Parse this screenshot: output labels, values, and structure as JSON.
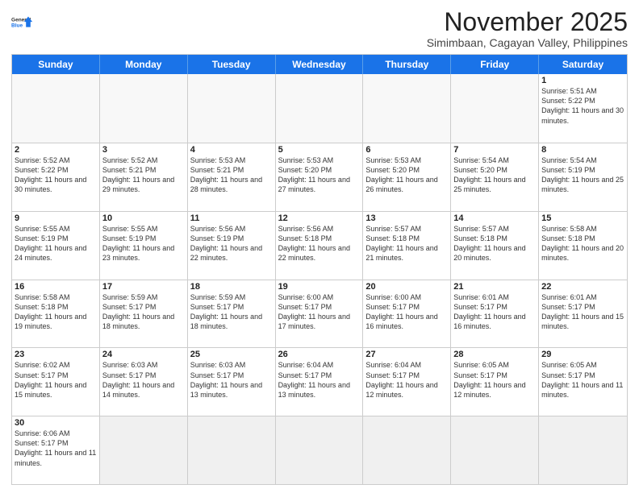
{
  "header": {
    "logo_general": "General",
    "logo_blue": "Blue",
    "month_title": "November 2025",
    "location": "Simimbaan, Cagayan Valley, Philippines"
  },
  "weekdays": [
    "Sunday",
    "Monday",
    "Tuesday",
    "Wednesday",
    "Thursday",
    "Friday",
    "Saturday"
  ],
  "rows": [
    [
      {
        "day": "",
        "info": "",
        "bg": "empty"
      },
      {
        "day": "",
        "info": "",
        "bg": "empty"
      },
      {
        "day": "",
        "info": "",
        "bg": "empty"
      },
      {
        "day": "",
        "info": "",
        "bg": "empty"
      },
      {
        "day": "",
        "info": "",
        "bg": "empty"
      },
      {
        "day": "",
        "info": "",
        "bg": "empty"
      },
      {
        "day": "1",
        "info": "Sunrise: 5:51 AM\nSunset: 5:22 PM\nDaylight: 11 hours and 30 minutes.",
        "bg": ""
      }
    ],
    [
      {
        "day": "2",
        "info": "Sunrise: 5:52 AM\nSunset: 5:22 PM\nDaylight: 11 hours and 30 minutes.",
        "bg": ""
      },
      {
        "day": "3",
        "info": "Sunrise: 5:52 AM\nSunset: 5:21 PM\nDaylight: 11 hours and 29 minutes.",
        "bg": ""
      },
      {
        "day": "4",
        "info": "Sunrise: 5:53 AM\nSunset: 5:21 PM\nDaylight: 11 hours and 28 minutes.",
        "bg": ""
      },
      {
        "day": "5",
        "info": "Sunrise: 5:53 AM\nSunset: 5:20 PM\nDaylight: 11 hours and 27 minutes.",
        "bg": ""
      },
      {
        "day": "6",
        "info": "Sunrise: 5:53 AM\nSunset: 5:20 PM\nDaylight: 11 hours and 26 minutes.",
        "bg": ""
      },
      {
        "day": "7",
        "info": "Sunrise: 5:54 AM\nSunset: 5:20 PM\nDaylight: 11 hours and 25 minutes.",
        "bg": ""
      },
      {
        "day": "8",
        "info": "Sunrise: 5:54 AM\nSunset: 5:19 PM\nDaylight: 11 hours and 25 minutes.",
        "bg": ""
      }
    ],
    [
      {
        "day": "9",
        "info": "Sunrise: 5:55 AM\nSunset: 5:19 PM\nDaylight: 11 hours and 24 minutes.",
        "bg": ""
      },
      {
        "day": "10",
        "info": "Sunrise: 5:55 AM\nSunset: 5:19 PM\nDaylight: 11 hours and 23 minutes.",
        "bg": ""
      },
      {
        "day": "11",
        "info": "Sunrise: 5:56 AM\nSunset: 5:19 PM\nDaylight: 11 hours and 22 minutes.",
        "bg": ""
      },
      {
        "day": "12",
        "info": "Sunrise: 5:56 AM\nSunset: 5:18 PM\nDaylight: 11 hours and 22 minutes.",
        "bg": ""
      },
      {
        "day": "13",
        "info": "Sunrise: 5:57 AM\nSunset: 5:18 PM\nDaylight: 11 hours and 21 minutes.",
        "bg": ""
      },
      {
        "day": "14",
        "info": "Sunrise: 5:57 AM\nSunset: 5:18 PM\nDaylight: 11 hours and 20 minutes.",
        "bg": ""
      },
      {
        "day": "15",
        "info": "Sunrise: 5:58 AM\nSunset: 5:18 PM\nDaylight: 11 hours and 20 minutes.",
        "bg": ""
      }
    ],
    [
      {
        "day": "16",
        "info": "Sunrise: 5:58 AM\nSunset: 5:18 PM\nDaylight: 11 hours and 19 minutes.",
        "bg": ""
      },
      {
        "day": "17",
        "info": "Sunrise: 5:59 AM\nSunset: 5:17 PM\nDaylight: 11 hours and 18 minutes.",
        "bg": ""
      },
      {
        "day": "18",
        "info": "Sunrise: 5:59 AM\nSunset: 5:17 PM\nDaylight: 11 hours and 18 minutes.",
        "bg": ""
      },
      {
        "day": "19",
        "info": "Sunrise: 6:00 AM\nSunset: 5:17 PM\nDaylight: 11 hours and 17 minutes.",
        "bg": ""
      },
      {
        "day": "20",
        "info": "Sunrise: 6:00 AM\nSunset: 5:17 PM\nDaylight: 11 hours and 16 minutes.",
        "bg": ""
      },
      {
        "day": "21",
        "info": "Sunrise: 6:01 AM\nSunset: 5:17 PM\nDaylight: 11 hours and 16 minutes.",
        "bg": ""
      },
      {
        "day": "22",
        "info": "Sunrise: 6:01 AM\nSunset: 5:17 PM\nDaylight: 11 hours and 15 minutes.",
        "bg": ""
      }
    ],
    [
      {
        "day": "23",
        "info": "Sunrise: 6:02 AM\nSunset: 5:17 PM\nDaylight: 11 hours and 15 minutes.",
        "bg": ""
      },
      {
        "day": "24",
        "info": "Sunrise: 6:03 AM\nSunset: 5:17 PM\nDaylight: 11 hours and 14 minutes.",
        "bg": ""
      },
      {
        "day": "25",
        "info": "Sunrise: 6:03 AM\nSunset: 5:17 PM\nDaylight: 11 hours and 13 minutes.",
        "bg": ""
      },
      {
        "day": "26",
        "info": "Sunrise: 6:04 AM\nSunset: 5:17 PM\nDaylight: 11 hours and 13 minutes.",
        "bg": ""
      },
      {
        "day": "27",
        "info": "Sunrise: 6:04 AM\nSunset: 5:17 PM\nDaylight: 11 hours and 12 minutes.",
        "bg": ""
      },
      {
        "day": "28",
        "info": "Sunrise: 6:05 AM\nSunset: 5:17 PM\nDaylight: 11 hours and 12 minutes.",
        "bg": ""
      },
      {
        "day": "29",
        "info": "Sunrise: 6:05 AM\nSunset: 5:17 PM\nDaylight: 11 hours and 11 minutes.",
        "bg": ""
      }
    ],
    [
      {
        "day": "30",
        "info": "Sunrise: 6:06 AM\nSunset: 5:17 PM\nDaylight: 11 hours and 11 minutes.",
        "bg": ""
      },
      {
        "day": "",
        "info": "",
        "bg": "gray-bg"
      },
      {
        "day": "",
        "info": "",
        "bg": "gray-bg"
      },
      {
        "day": "",
        "info": "",
        "bg": "gray-bg"
      },
      {
        "day": "",
        "info": "",
        "bg": "gray-bg"
      },
      {
        "day": "",
        "info": "",
        "bg": "gray-bg"
      },
      {
        "day": "",
        "info": "",
        "bg": "gray-bg"
      }
    ]
  ]
}
